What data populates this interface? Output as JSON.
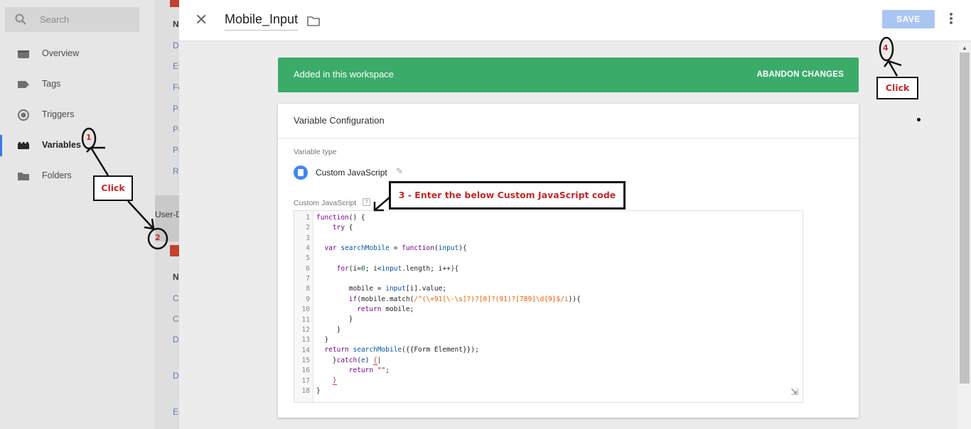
{
  "sidebar": {
    "search_placeholder": "Search",
    "items": [
      {
        "label": "Overview",
        "icon": "overview-icon"
      },
      {
        "label": "Tags",
        "icon": "tag-icon"
      },
      {
        "label": "Triggers",
        "icon": "trigger-icon"
      },
      {
        "label": "Variables",
        "icon": "variables-icon",
        "active": true
      },
      {
        "label": "Folders",
        "icon": "folder-icon"
      }
    ]
  },
  "background": {
    "links": [
      "De",
      "Ev",
      "Fo",
      "Pa",
      "Pa",
      "Pa",
      "Re",
      "Co",
      "Co",
      "DI",
      "DI",
      "Er"
    ],
    "heading_a": "Na",
    "heading_b": "Na",
    "section_text": "User-D"
  },
  "panel": {
    "title": "Mobile_Input",
    "save_label": "SAVE",
    "accent": "#a9c6f2",
    "banner": {
      "message": "Added in this workspace",
      "action": "ABANDON CHANGES",
      "color": "#3bab6a"
    },
    "config": {
      "header": "Variable Configuration",
      "variable_type_label": "Variable type",
      "variable_type": "Custom JavaScript",
      "code_label": "Custom JavaScript",
      "help_glyph": "?",
      "line_numbers": [
        "1",
        "2",
        "3",
        "4",
        "5",
        "6",
        "7",
        "8",
        "9",
        "10",
        "11",
        "12",
        "13",
        "14",
        "15",
        "16",
        "17",
        "18"
      ]
    }
  },
  "annotations": {
    "click_1": "Click",
    "click_4": "Click",
    "step_3": "3 - Enter the below Custom JavaScript code",
    "n1": "1",
    "n2": "2",
    "n4": "4"
  }
}
